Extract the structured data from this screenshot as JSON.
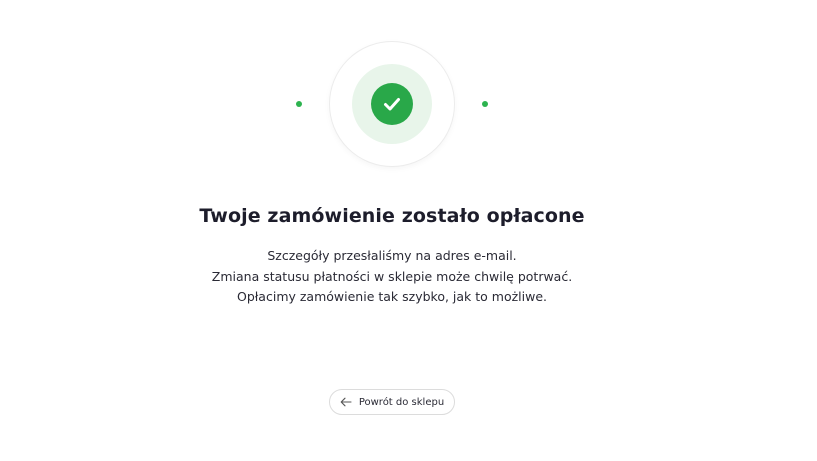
{
  "colors": {
    "accent": "#29a849",
    "halo": "#e8f5ea",
    "dot": "#2db34f"
  },
  "status": {
    "icon": "checkmark-icon",
    "title": "Twoje zamówienie zostało opłacone",
    "messages": [
      "Szczegóły przesłaliśmy na adres e-mail.",
      "Zmiana statusu płatności w sklepie może chwilę potrwać.",
      "Opłacimy zamówienie tak szybko, jak to możliwe."
    ]
  },
  "back_button": {
    "icon": "arrow-left-icon",
    "label": "Powrót do sklepu"
  }
}
